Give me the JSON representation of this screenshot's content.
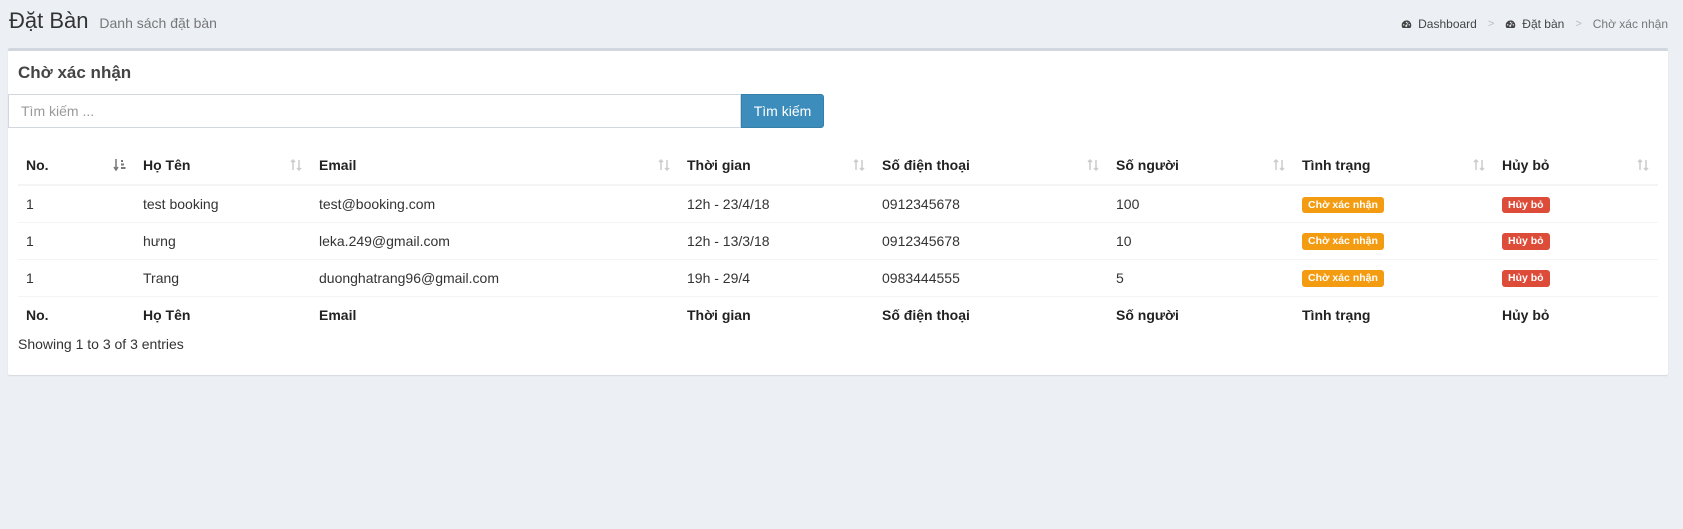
{
  "header": {
    "title": "Đặt Bàn",
    "subtitle": "Danh sách đặt bàn"
  },
  "breadcrumb": [
    {
      "label": "Dashboard",
      "icon": "dashboard-icon"
    },
    {
      "label": "Đặt bàn",
      "icon": "dashboard-icon"
    },
    {
      "label": "Chờ xác nhận"
    }
  ],
  "box": {
    "title": "Chờ xác nhận"
  },
  "search": {
    "placeholder": "Tìm kiếm ...",
    "value": "",
    "button_label": "Tìm kiếm"
  },
  "table": {
    "columns": [
      "No.",
      "Họ Tên",
      "Email",
      "Thời gian",
      "Số điện thoại",
      "Số người",
      "Tình trạng",
      "Hủy bỏ"
    ],
    "rows": [
      {
        "no": "1",
        "name": "test booking",
        "email": "test@booking.com",
        "time": "12h - 23/4/18",
        "phone": "0912345678",
        "people": "100",
        "status": "Chờ xác nhận",
        "cancel": "Hủy bỏ"
      },
      {
        "no": "1",
        "name": "hưng",
        "email": "leka.249@gmail.com",
        "time": "12h - 13/3/18",
        "phone": "0912345678",
        "people": "10",
        "status": "Chờ xác nhận",
        "cancel": "Hủy bỏ"
      },
      {
        "no": "1",
        "name": "Trang",
        "email": "duonghatrang96@gmail.com",
        "time": "19h - 29/4",
        "phone": "0983444555",
        "people": "5",
        "status": "Chờ xác nhận",
        "cancel": "Hủy bỏ"
      }
    ],
    "info": "Showing 1 to 3 of 3 entries"
  },
  "colors": {
    "primary": "#3c8dbc",
    "warning": "#f39c12",
    "danger": "#dd4b39",
    "background": "#ecf0f5"
  }
}
